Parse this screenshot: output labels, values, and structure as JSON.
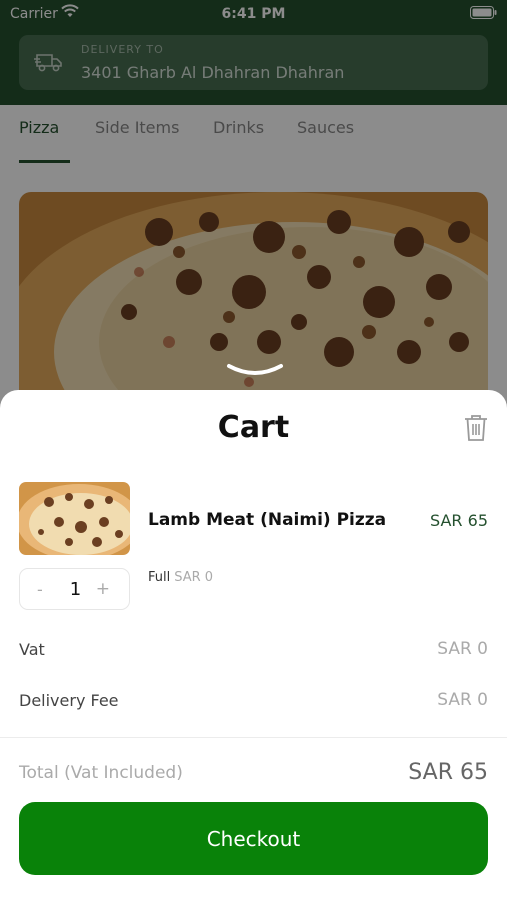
{
  "status_bar": {
    "carrier": "Carrier",
    "time": "6:41 PM"
  },
  "delivery": {
    "label": "DELIVERY TO",
    "address": "3401 Gharb Al Dhahran Dhahran"
  },
  "tabs": [
    {
      "label": "Pizza",
      "active": true
    },
    {
      "label": "Side Items"
    },
    {
      "label": "Drinks"
    },
    {
      "label": "Sauces"
    }
  ],
  "cart": {
    "title": "Cart",
    "item": {
      "name": "Lamb Meat (Naimi) Pizza",
      "price": "SAR 65",
      "quantity": "1",
      "decrement": "-",
      "increment": "+",
      "variant_name": "Full",
      "variant_price": "SAR 0"
    },
    "vat": {
      "label": "Vat",
      "value": "SAR 0"
    },
    "delivery_fee": {
      "label": "Delivery Fee",
      "value": "SAR 0"
    },
    "total": {
      "label": "Total",
      "note": "(Vat Included)",
      "value": "SAR 65"
    },
    "checkout_label": "Checkout"
  },
  "colors": {
    "brand": "#25512f",
    "checkout": "#098209",
    "price": "#25512f"
  }
}
